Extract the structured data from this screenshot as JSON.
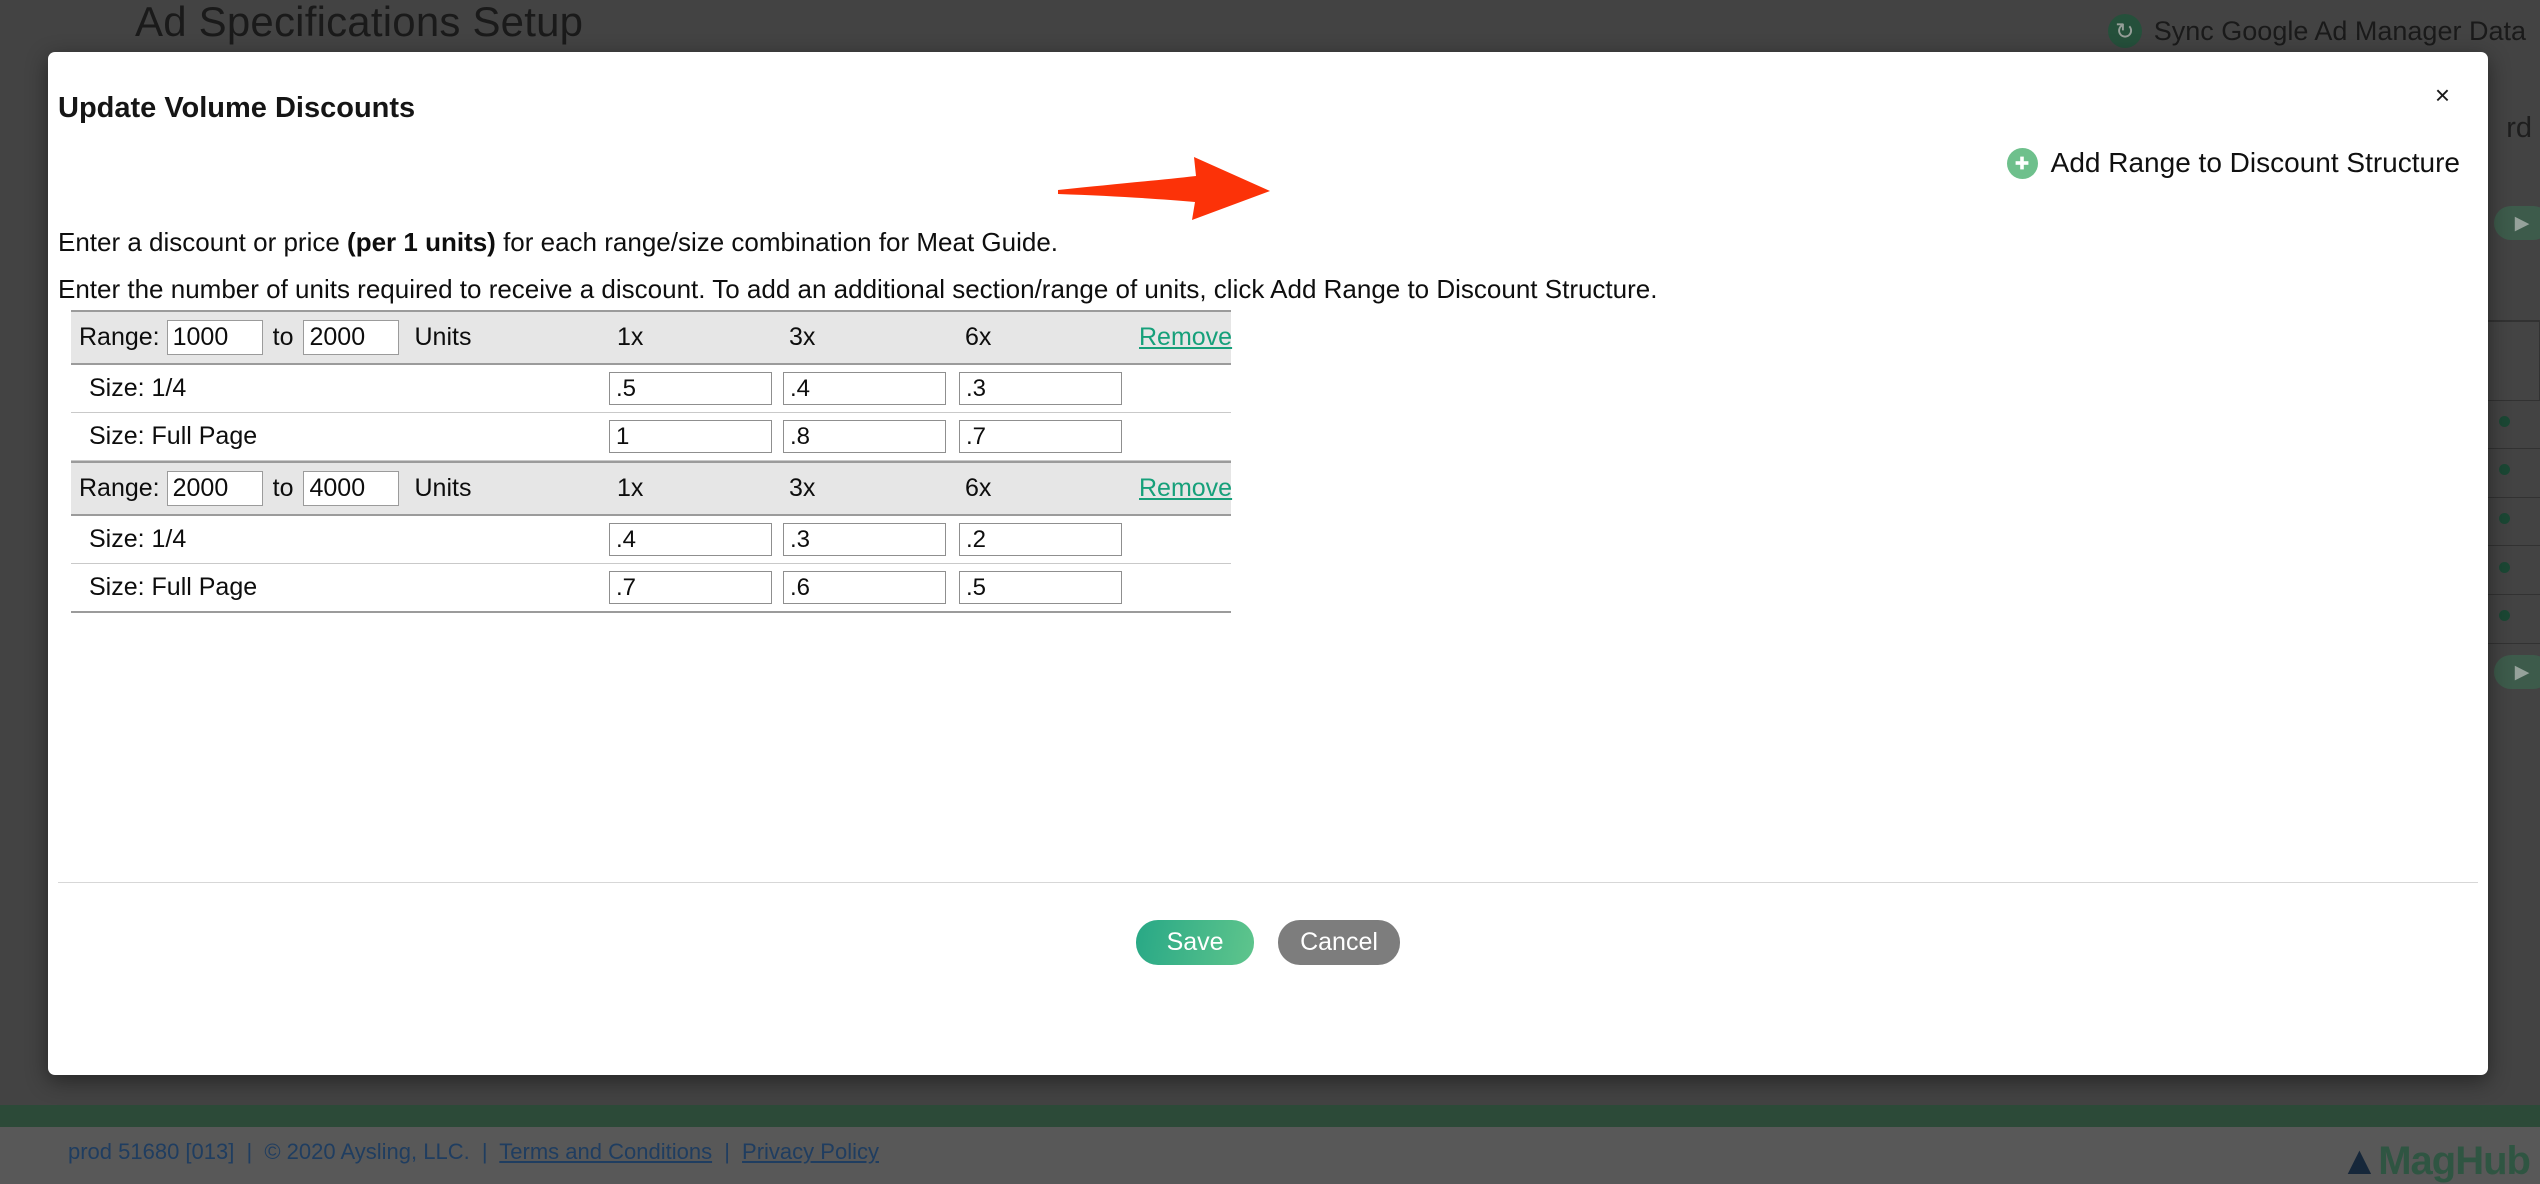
{
  "background": {
    "page_title": "Ad Specifications Setup",
    "sync_label": "Sync Google Ad Manager Data",
    "sync_icon": "sync-circular-arrow-icon",
    "partial_heading": "rd"
  },
  "modal": {
    "title": "Update Volume Discounts",
    "close_label": "×",
    "add_range": {
      "label": "Add Range to Discount Structure",
      "icon": "plus-circle-icon",
      "accent_color": "#6ec08c"
    },
    "annotation": {
      "type": "red-arrow",
      "color": "#fc3208"
    },
    "instructions": {
      "line1_part1": "Enter a discount or price ",
      "line1_bold": "(per 1 units)",
      "line1_part2": " for each range/size combination for Meat Guide.",
      "line2": "Enter the number of units required to receive a discount. To add an additional section/range of units, click Add Range to Discount Structure."
    },
    "table": {
      "range_label": "Range:",
      "to_label": "to",
      "units_label": "Units",
      "remove_label": "Remove",
      "multiplier_headers": [
        "1x",
        "3x",
        "6x"
      ],
      "sections": [
        {
          "range_from": "1000",
          "range_to": "2000",
          "rows": [
            {
              "size_label": "Size: 1/4",
              "values": [
                ".5",
                ".4",
                ".3"
              ]
            },
            {
              "size_label": "Size: Full Page",
              "values": [
                "1",
                ".8",
                ".7"
              ]
            }
          ]
        },
        {
          "range_from": "2000",
          "range_to": "4000",
          "rows": [
            {
              "size_label": "Size: 1/4",
              "values": [
                ".4",
                ".3",
                ".2"
              ]
            },
            {
              "size_label": "Size: Full Page",
              "values": [
                ".7",
                ".6",
                ".5"
              ]
            }
          ]
        }
      ]
    },
    "actions": {
      "save_label": "Save",
      "cancel_label": "Cancel",
      "save_color": "#3fb58b",
      "cancel_color": "#7d7d7d"
    }
  },
  "footer": {
    "build": "prod 51680 [013]",
    "copyright": "© 2020 Aysling, LLC.",
    "terms_label": "Terms and Conditions",
    "privacy_label": "Privacy Policy",
    "separator": "|",
    "logo_text": "MagHub",
    "bar_color": "#2c4a38"
  }
}
